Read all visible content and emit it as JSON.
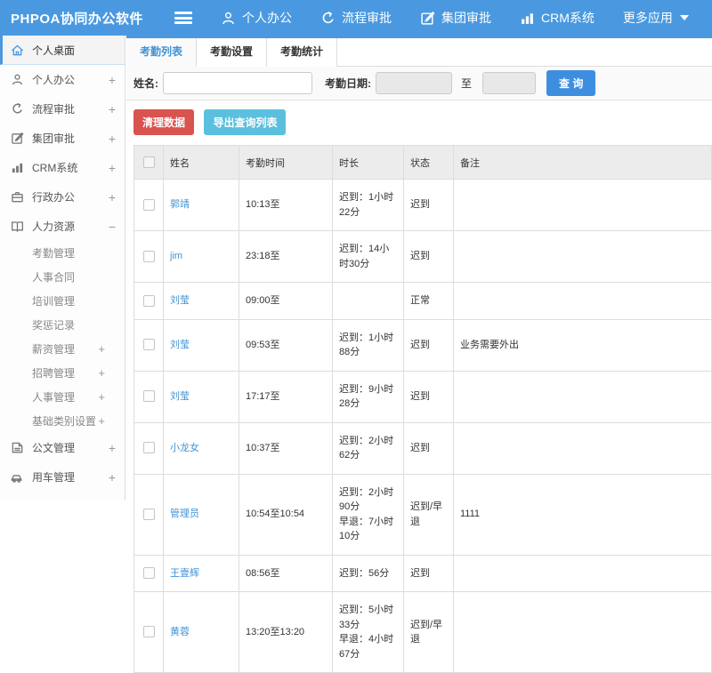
{
  "header": {
    "logo": "PHPOA协同办公软件",
    "nav": [
      {
        "label": "个人办公",
        "icon": "person-icon"
      },
      {
        "label": "流程审批",
        "icon": "flow-icon"
      },
      {
        "label": "集团审批",
        "icon": "edit-icon"
      },
      {
        "label": "CRM系统",
        "icon": "chart-icon"
      },
      {
        "label": "更多应用",
        "icon": "caret-down-icon"
      }
    ]
  },
  "sidebar": {
    "items": [
      {
        "label": "个人桌面",
        "icon": "home-icon",
        "active": true
      },
      {
        "label": "个人办公",
        "icon": "person-icon",
        "expand": "+"
      },
      {
        "label": "流程审批",
        "icon": "flow-icon",
        "expand": "+"
      },
      {
        "label": "集团审批",
        "icon": "edit-icon",
        "expand": "+"
      },
      {
        "label": "CRM系统",
        "icon": "chart-icon",
        "expand": "+"
      },
      {
        "label": "行政办公",
        "icon": "briefcase-icon",
        "expand": "+"
      },
      {
        "label": "人力资源",
        "icon": "book-icon",
        "expand": "−",
        "expanded": true
      },
      {
        "label": "公文管理",
        "icon": "document-icon",
        "expand": "+"
      },
      {
        "label": "用车管理",
        "icon": "car-icon",
        "expand": "+"
      }
    ],
    "hr_submenu": [
      {
        "label": "考勤管理"
      },
      {
        "label": "人事合同"
      },
      {
        "label": "培训管理"
      },
      {
        "label": "奖惩记录"
      },
      {
        "label": "薪资管理",
        "expand": "+"
      },
      {
        "label": "招聘管理",
        "expand": "+"
      },
      {
        "label": "人事管理",
        "expand": "+"
      },
      {
        "label": "基础类别设置",
        "expand": "+"
      }
    ]
  },
  "tabs": [
    {
      "label": "考勤列表",
      "active": true
    },
    {
      "label": "考勤设置",
      "active": false
    },
    {
      "label": "考勤统计",
      "active": false
    }
  ],
  "search": {
    "name_label": "姓名:",
    "name_value": "",
    "date_label": "考勤日期:",
    "date_from_value": "",
    "to_label": "至",
    "date_to_value": "",
    "submit_label": "查 询"
  },
  "actions": {
    "clean_label": "清理数据",
    "export_label": "导出查询列表"
  },
  "table": {
    "columns": [
      "姓名",
      "考勤时间",
      "时长",
      "状态",
      "备注"
    ],
    "rows": [
      {
        "name": "郭靖",
        "time": "10:13至",
        "duration": [
          "迟到：1小时22分"
        ],
        "status": "迟到",
        "status_red": true,
        "remark": ""
      },
      {
        "name": "jim",
        "time": "23:18至",
        "duration": [
          "迟到：14小时30分"
        ],
        "status": "迟到",
        "status_red": true,
        "remark": ""
      },
      {
        "name": "刘莹",
        "time": "09:00至",
        "duration": [],
        "status": "正常",
        "status_red": false,
        "remark": ""
      },
      {
        "name": "刘莹",
        "time": "09:53至",
        "duration": [
          "迟到：1小时88分"
        ],
        "status": "迟到",
        "status_red": true,
        "remark": "业务需要外出"
      },
      {
        "name": "刘莹",
        "time": "17:17至",
        "duration": [
          "迟到：9小时28分"
        ],
        "status": "迟到",
        "status_red": true,
        "remark": ""
      },
      {
        "name": "小龙女",
        "time": "10:37至",
        "duration": [
          "迟到：2小时62分"
        ],
        "status": "迟到",
        "status_red": true,
        "remark": ""
      },
      {
        "name": "管理员",
        "time": "10:54至10:54",
        "duration": [
          "迟到：2小时90分",
          "早退：7小时10分"
        ],
        "status": "迟到/早退",
        "status_red": true,
        "remark": "1111"
      },
      {
        "name": "王壹辉",
        "time": "08:56至",
        "duration": [
          "迟到：56分"
        ],
        "status": "迟到",
        "status_red": true,
        "remark": ""
      },
      {
        "name": "黄蓉",
        "time": "13:20至13:20",
        "duration": [
          "迟到：5小时33分",
          "早退：4小时67分"
        ],
        "status": "迟到/早退",
        "status_red": true,
        "remark": ""
      }
    ]
  },
  "colors": {
    "accent_blue": "#4a99e0",
    "link_blue": "#4193d5",
    "query_button_blue": "#3e8ee0",
    "danger_red": "#d9534f",
    "status_red": "#d9433c",
    "info_teal": "#5bc0de",
    "table_header_bg": "#ececec",
    "panel_bg": "#fafafa",
    "border": "#dddddd"
  }
}
